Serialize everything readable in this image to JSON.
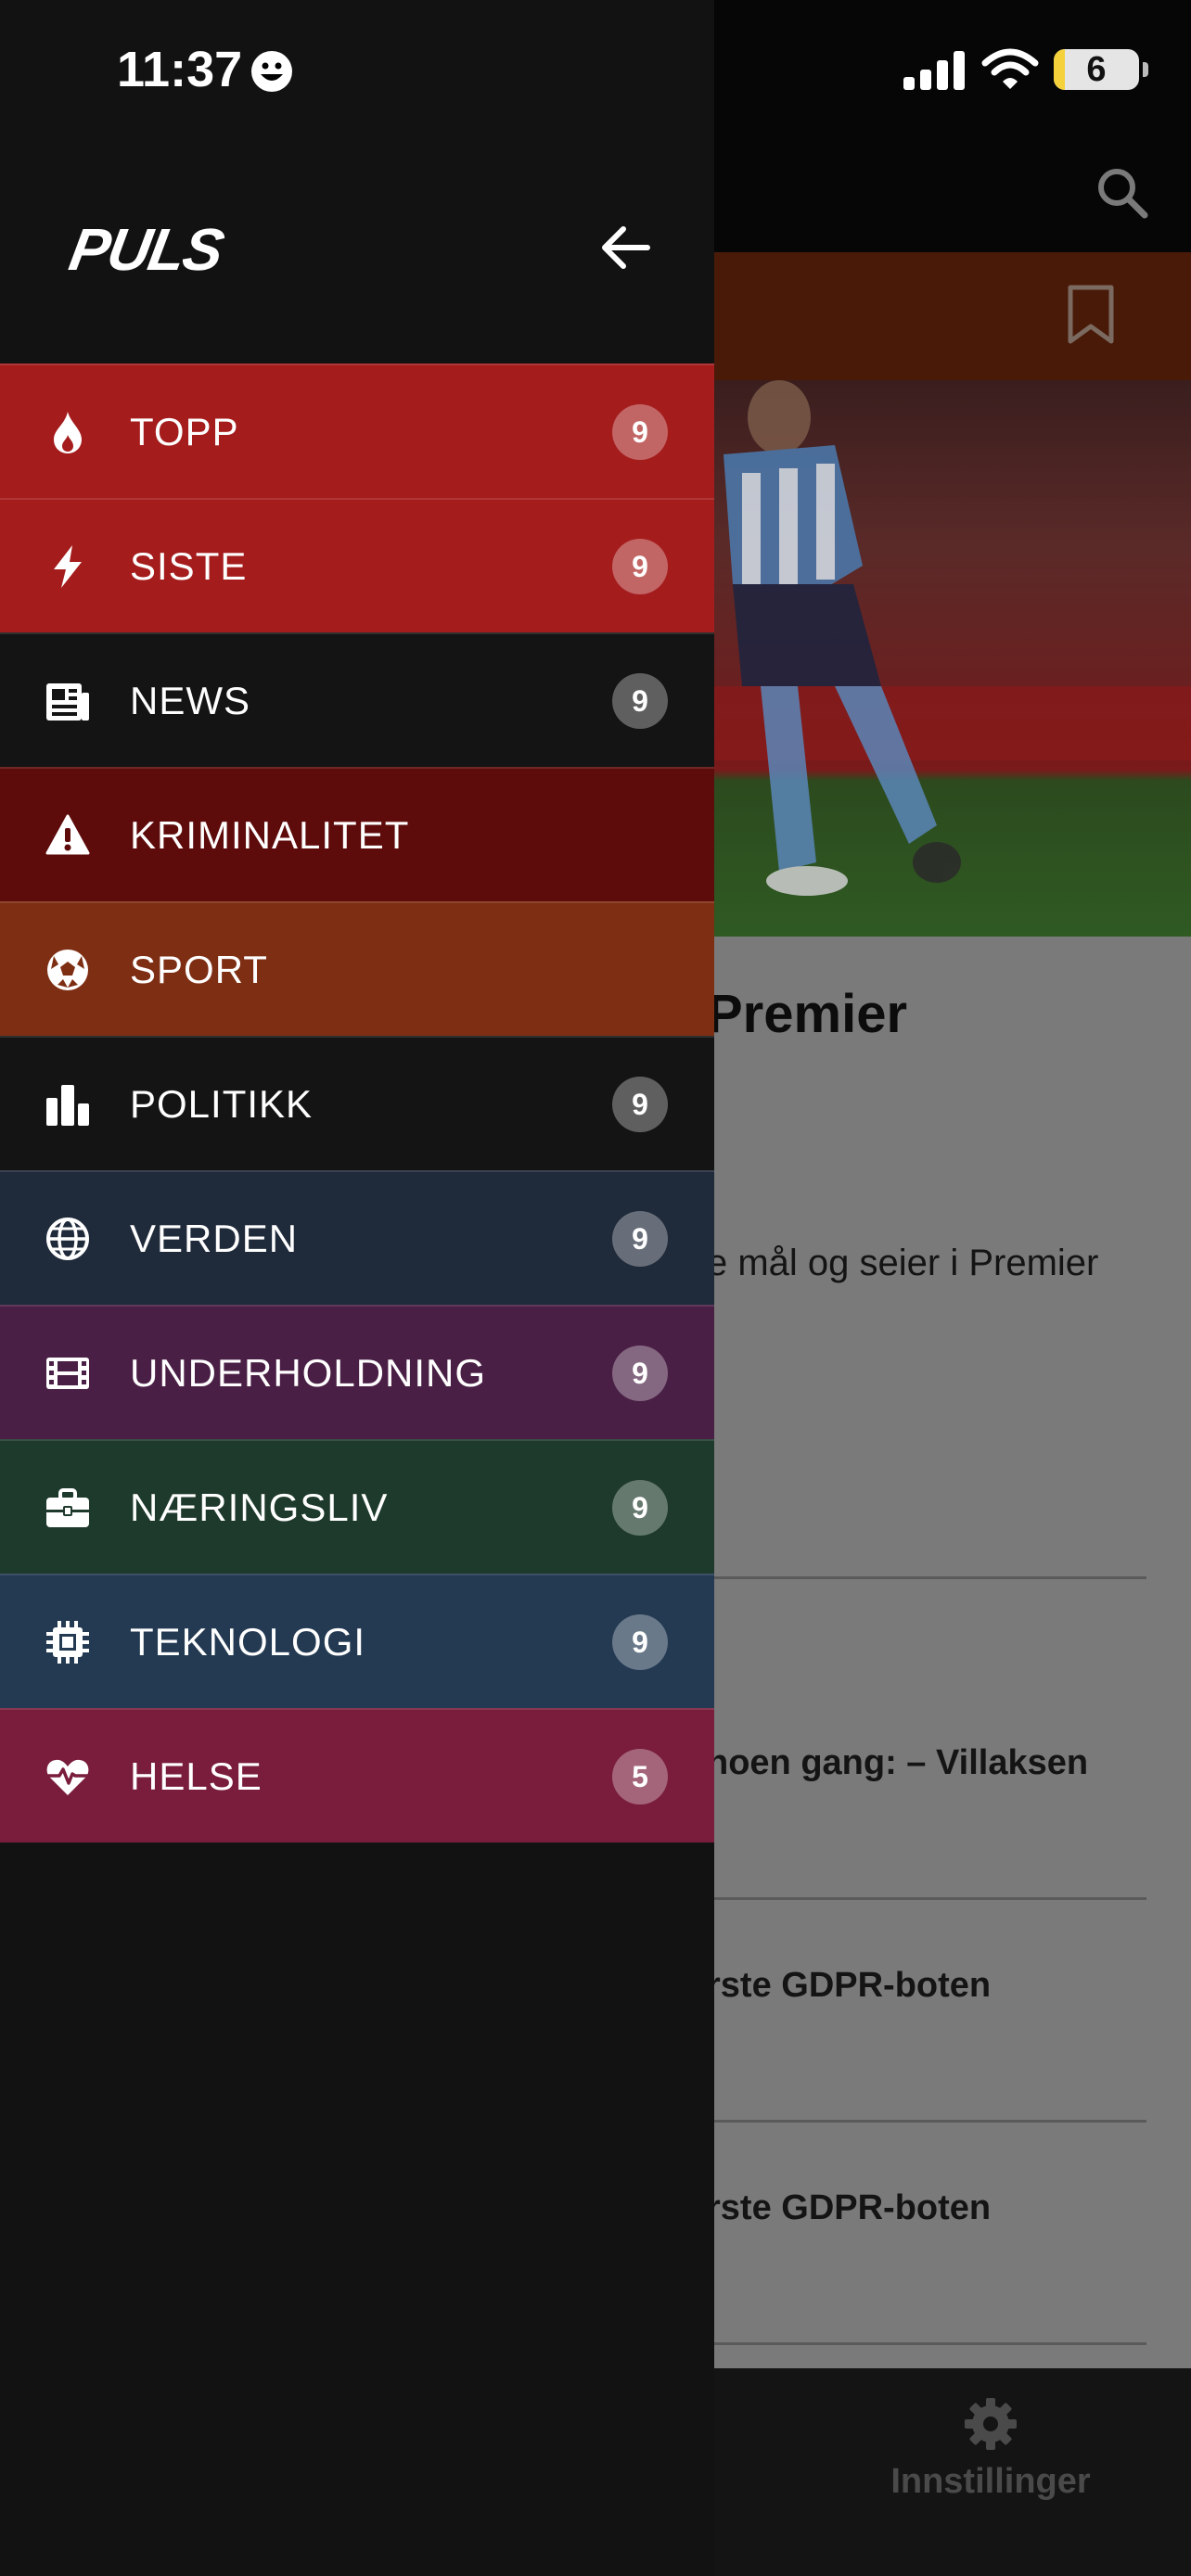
{
  "status_bar": {
    "time": "11:37",
    "battery_level": "6"
  },
  "drawer": {
    "logo": "PULS",
    "items": [
      {
        "label": "TOPP",
        "count": "9",
        "icon": "flame-icon",
        "color": "#a51c1c"
      },
      {
        "label": "SISTE",
        "count": "9",
        "icon": "lightning-icon",
        "color": "#a51c1c"
      },
      {
        "label": "NEWS",
        "count": "9",
        "icon": "newspaper-icon",
        "color": "#141414"
      },
      {
        "label": "KRIMINALITET",
        "count": "",
        "icon": "warning-icon",
        "color": "#5e0b0b"
      },
      {
        "label": "SPORT",
        "count": "",
        "icon": "soccer-ball-icon",
        "color": "#7e2e13"
      },
      {
        "label": "POLITIKK",
        "count": "9",
        "icon": "bar-chart-icon",
        "color": "#141414"
      },
      {
        "label": "VERDEN",
        "count": "9",
        "icon": "globe-icon",
        "color": "#1f2a3a"
      },
      {
        "label": "UNDERHOLDNING",
        "count": "9",
        "icon": "film-icon",
        "color": "#4a1f45"
      },
      {
        "label": "NÆRINGSLIV",
        "count": "9",
        "icon": "briefcase-icon",
        "color": "#1e3a2c"
      },
      {
        "label": "TEKNOLOGI",
        "count": "9",
        "icon": "chip-icon",
        "color": "#233a52"
      },
      {
        "label": "HELSE",
        "count": "5",
        "icon": "heart-pulse-icon",
        "color": "#7a1d3d"
      }
    ]
  },
  "background": {
    "article_title": "Premier",
    "article_summary": "e mål og seier i Premier",
    "headlines": [
      "noen gang: – Villaksen",
      "rste GDPR-boten",
      "rste GDPR-boten"
    ],
    "settings_label": "Innstillinger"
  }
}
